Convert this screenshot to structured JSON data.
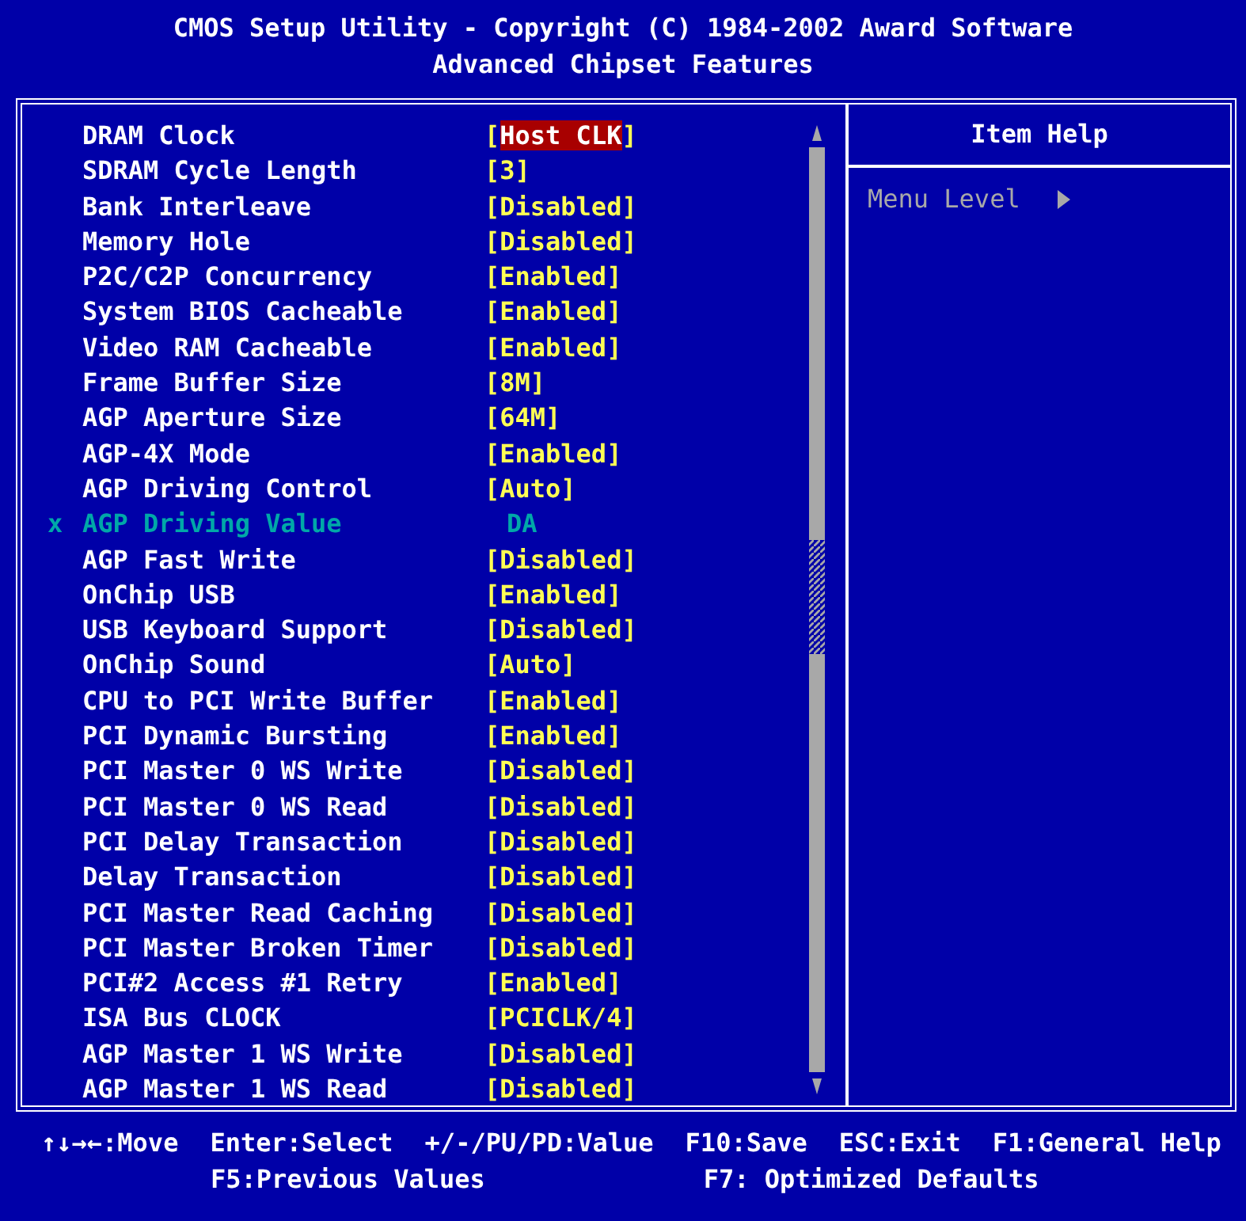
{
  "header": {
    "title": "CMOS Setup Utility - Copyright (C) 1984-2002 Award Software",
    "subtitle": "Advanced Chipset Features"
  },
  "items": [
    {
      "label": "DRAM Clock",
      "value": "[Host CLK]",
      "selected": true,
      "disabled": false
    },
    {
      "label": "SDRAM Cycle Length",
      "value": "[3]",
      "selected": false,
      "disabled": false
    },
    {
      "label": "Bank Interleave",
      "value": "[Disabled]",
      "selected": false,
      "disabled": false
    },
    {
      "label": "Memory Hole",
      "value": "[Disabled]",
      "selected": false,
      "disabled": false
    },
    {
      "label": "P2C/C2P Concurrency",
      "value": "[Enabled]",
      "selected": false,
      "disabled": false
    },
    {
      "label": "System BIOS Cacheable",
      "value": "[Enabled]",
      "selected": false,
      "disabled": false
    },
    {
      "label": "Video RAM Cacheable",
      "value": "[Enabled]",
      "selected": false,
      "disabled": false
    },
    {
      "label": "Frame Buffer Size",
      "value": "[8M]",
      "selected": false,
      "disabled": false
    },
    {
      "label": "AGP Aperture Size",
      "value": "[64M]",
      "selected": false,
      "disabled": false
    },
    {
      "label": "AGP-4X Mode",
      "value": "[Enabled]",
      "selected": false,
      "disabled": false
    },
    {
      "label": "AGP Driving Control",
      "value": "[Auto]",
      "selected": false,
      "disabled": false
    },
    {
      "label": "AGP Driving Value",
      "value": "DA",
      "selected": false,
      "disabled": true,
      "marker": "x"
    },
    {
      "label": "AGP Fast Write",
      "value": "[Disabled]",
      "selected": false,
      "disabled": false
    },
    {
      "label": "OnChip USB",
      "value": "[Enabled]",
      "selected": false,
      "disabled": false
    },
    {
      "label": "USB Keyboard Support",
      "value": "[Disabled]",
      "selected": false,
      "disabled": false
    },
    {
      "label": "OnChip Sound",
      "value": "[Auto]",
      "selected": false,
      "disabled": false
    },
    {
      "label": "CPU to PCI Write Buffer",
      "value": "[Enabled]",
      "selected": false,
      "disabled": false
    },
    {
      "label": "PCI Dynamic Bursting",
      "value": "[Enabled]",
      "selected": false,
      "disabled": false
    },
    {
      "label": "PCI Master 0 WS Write",
      "value": "[Disabled]",
      "selected": false,
      "disabled": false
    },
    {
      "label": "PCI Master 0 WS Read",
      "value": "[Disabled]",
      "selected": false,
      "disabled": false
    },
    {
      "label": "PCI Delay Transaction",
      "value": "[Disabled]",
      "selected": false,
      "disabled": false
    },
    {
      "label": "Delay Transaction",
      "value": "[Disabled]",
      "selected": false,
      "disabled": false
    },
    {
      "label": "PCI Master Read Caching",
      "value": "[Disabled]",
      "selected": false,
      "disabled": false
    },
    {
      "label": "PCI Master Broken Timer",
      "value": "[Disabled]",
      "selected": false,
      "disabled": false
    },
    {
      "label": "PCI#2 Access #1 Retry",
      "value": "[Enabled]",
      "selected": false,
      "disabled": false
    },
    {
      "label": "ISA Bus CLOCK",
      "value": "[PCICLK/4]",
      "selected": false,
      "disabled": false
    },
    {
      "label": "AGP Master 1 WS Write",
      "value": "[Disabled]",
      "selected": false,
      "disabled": false
    },
    {
      "label": "AGP Master 1 WS Read",
      "value": "[Disabled]",
      "selected": false,
      "disabled": false
    }
  ],
  "help": {
    "title": "Item Help",
    "menu_level": "Menu Level"
  },
  "footer": {
    "row_1": [
      "↑↓→←:Move",
      "Enter:Select",
      "+/-/PU/PD:Value",
      "F10:Save",
      "ESC:Exit",
      "F1:General Help"
    ],
    "row_2": [
      "F5:Previous Values",
      "F7: Optimized Defaults"
    ]
  }
}
